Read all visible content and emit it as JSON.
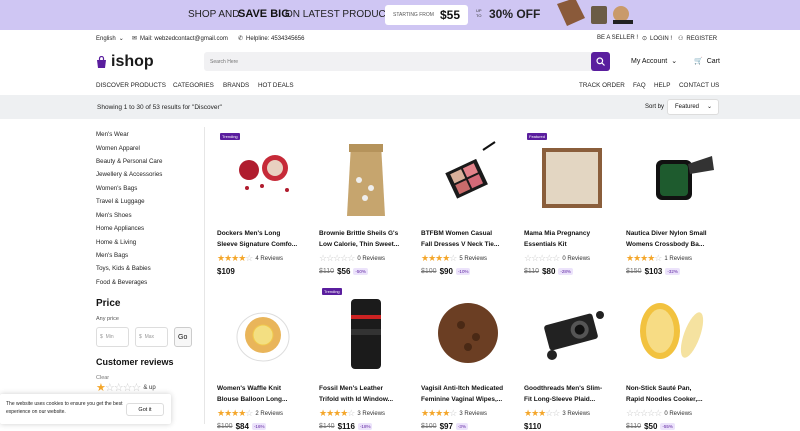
{
  "banner": {
    "t1": "SHOP AND",
    "t2": "SAVE BIG",
    "t3": "ON LATEST PRODUCTS",
    "starting": "STARTING FROM",
    "price": "$55",
    "upto": "UP TO",
    "off": "30% OFF"
  },
  "topbar": {
    "language": "English",
    "email": "Mail: webzedcontact@gmail.com",
    "helpline": "Helpline: 4534345656",
    "seller": "BE A SELLER !",
    "login": "LOGIN !",
    "register": "REGISTER"
  },
  "header": {
    "logo": "ishop",
    "search_placeholder": "Search Here",
    "account": "My Account",
    "cart": "Cart"
  },
  "nav": {
    "left": [
      "DISCOVER PRODUCTS",
      "CATEGORIES",
      "BRANDS",
      "HOT DEALS"
    ],
    "right": [
      "TRACK ORDER",
      "FAQ",
      "HELP",
      "CONTACT US"
    ]
  },
  "results": {
    "text": "Showing 1 to 30 of 53 results for \"Discover\"",
    "sort_label": "Sort by",
    "sort_value": "Featured"
  },
  "categories": [
    "Men's Wear",
    "Women Apparel",
    "Beauty & Personal Care",
    "Jewellery & Accessories",
    "Women's Bags",
    "Travel & Luggage",
    "Men's Shoes",
    "Home Appliances",
    "Home & Living",
    "Men's Bags",
    "Toys, Kids & Babies",
    "Food & Beverages"
  ],
  "price": {
    "heading": "Price",
    "any": "Any price",
    "currency": "$",
    "min": "Min",
    "max": "Max",
    "go": "Go"
  },
  "reviews": {
    "heading": "Customer reviews",
    "clear": "Clear",
    "up": "& up"
  },
  "cookie": {
    "text": "The website uses cookies to ensure you get the best experience on our website.",
    "button": "Got it"
  },
  "products": [
    {
      "badge": "Trending",
      "name": "Dockers Men's Long\nSleeve Signature Comfo...",
      "rating": 4,
      "reviews": "4 Reviews",
      "old": "",
      "price": "$109",
      "disc": "",
      "img": "pomegranate"
    },
    {
      "badge": "",
      "name": "Brownie Brittle Sheils G's\nLow Calorie, Thin Sweet...",
      "rating": 0,
      "reviews": "0 Reviews",
      "old": "$110",
      "price": "$56",
      "disc": "-50%",
      "img": "bag"
    },
    {
      "badge": "",
      "name": "BTFBM Women Casual\nFall Dresses V Neck Tie...",
      "rating": 4,
      "reviews": "5 Reviews",
      "old": "$100",
      "price": "$90",
      "disc": "-10%",
      "img": "palette"
    },
    {
      "badge": "Featured",
      "name": "Mama Mia Pregnancy\nEssentials Kit",
      "rating": 0,
      "reviews": "0 Reviews",
      "old": "$110",
      "price": "$80",
      "disc": "-28%",
      "img": "pistachio"
    },
    {
      "badge": "",
      "name": "Nautica Diver Nylon Small\nWomens Crossbody Ba...",
      "rating": 4,
      "reviews": "1 Reviews",
      "old": "$150",
      "price": "$103",
      "disc": "-32%",
      "img": "watch"
    },
    {
      "badge": "",
      "name": "Women's Waffle Knit\nBlouse Balloon Long...",
      "rating": 4,
      "reviews": "2 Reviews",
      "old": "$100",
      "price": "$84",
      "disc": "-16%",
      "img": "tea"
    },
    {
      "badge": "Trending",
      "name": "Fossil Men's Leather\nTrifold with Id Window...",
      "rating": 4,
      "reviews": "3 Reviews",
      "old": "$140",
      "price": "$116",
      "disc": "-18%",
      "img": "lens"
    },
    {
      "badge": "",
      "name": "Vagisil Anti-Itch Medicated\nFeminine Vaginal Wipes,...",
      "rating": 4,
      "reviews": "3 Reviews",
      "old": "$100",
      "price": "$97",
      "disc": "-3%",
      "img": "coffee"
    },
    {
      "badge": "",
      "name": "Goodthreads Men's Slim-\nFit Long-Sleeve Plaid...",
      "rating": 3,
      "reviews": "3 Reviews",
      "old": "",
      "price": "$110",
      "disc": "",
      "img": "camera"
    },
    {
      "badge": "",
      "name": "Non-Stick Sauté Pan,\nRapid Noodles Cooker,...",
      "rating": 0,
      "reviews": "0 Reviews",
      "old": "$110",
      "price": "$50",
      "disc": "-55%",
      "img": "melon"
    }
  ]
}
